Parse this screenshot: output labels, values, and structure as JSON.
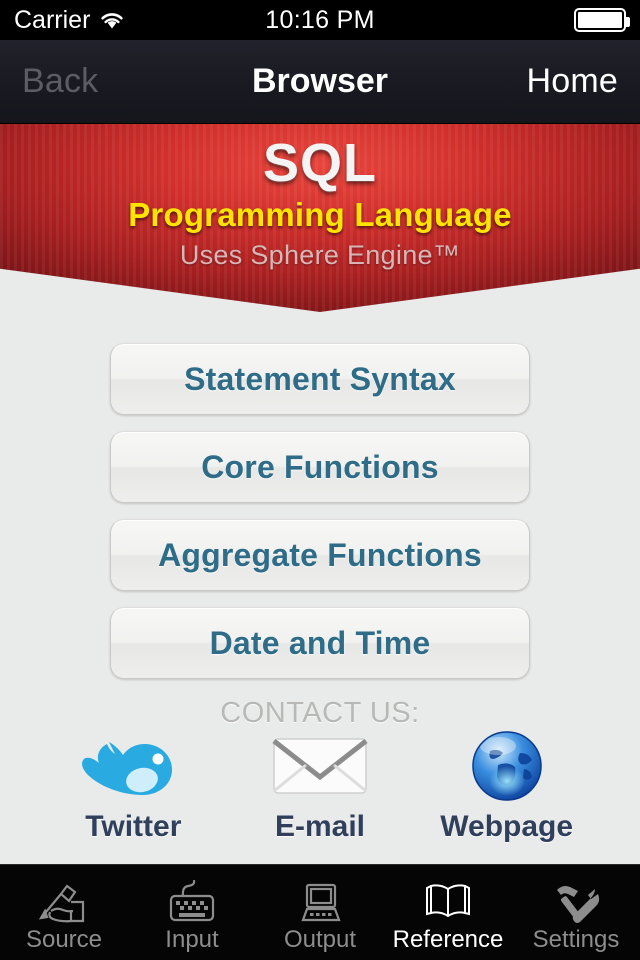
{
  "status_bar": {
    "carrier": "Carrier",
    "wifi_icon": "wifi-icon",
    "time": "10:16 PM",
    "battery_icon": "battery-full-icon"
  },
  "nav_bar": {
    "back_label": "Back",
    "title": "Browser",
    "home_label": "Home"
  },
  "banner": {
    "title": "SQL",
    "subtitle": "Programming Language",
    "note": "Uses Sphere Engine™",
    "colors": {
      "red_light": "#e8453c",
      "red_dark": "#771316",
      "title_color": "#f4f4f4",
      "subtitle_color": "#ffe400",
      "note_color": "#d9b6b6"
    }
  },
  "menu": {
    "buttons": [
      {
        "label": "Statement Syntax"
      },
      {
        "label": "Core Functions"
      },
      {
        "label": "Aggregate Functions"
      },
      {
        "label": "Date and Time"
      }
    ],
    "text_color": "#2e6c88"
  },
  "contact": {
    "heading": "CONTACT US:",
    "items": [
      {
        "label": "Twitter",
        "icon": "twitter-bird-icon"
      },
      {
        "label": "E-mail",
        "icon": "envelope-icon"
      },
      {
        "label": "Webpage",
        "icon": "globe-icon"
      }
    ],
    "label_color": "#30405c"
  },
  "tab_bar": {
    "active_index": 3,
    "tabs": [
      {
        "label": "Source",
        "icon": "hand-writing-icon"
      },
      {
        "label": "Input",
        "icon": "keyboard-icon"
      },
      {
        "label": "Output",
        "icon": "laptop-icon"
      },
      {
        "label": "Reference",
        "icon": "open-book-icon"
      },
      {
        "label": "Settings",
        "icon": "hammer-wrench-icon"
      }
    ],
    "active_color": "#ffffff",
    "inactive_color": "#8d8d8d"
  }
}
